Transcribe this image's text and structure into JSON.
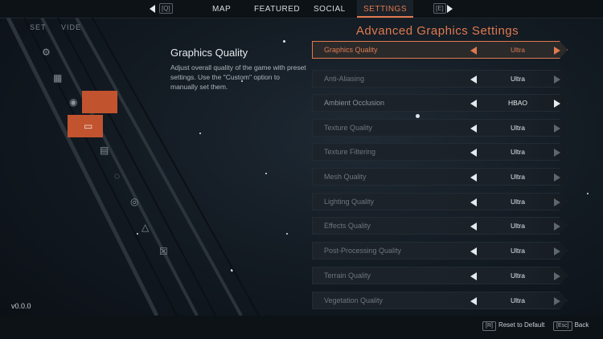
{
  "nav": {
    "prev_key": "[Q]",
    "next_key": "[E]",
    "tabs": [
      "MAP",
      "FEATURED",
      "SOCIAL",
      "SETTINGS"
    ],
    "active_tab": "SETTINGS"
  },
  "left_panel": {
    "labels": [
      "SET",
      "VIDE"
    ]
  },
  "description": {
    "title": "Graphics Quality",
    "body": "Adjust overall quality of the game with preset settings. Use the \"Custom\" option to manually set them."
  },
  "panel": {
    "title": "Advanced Graphics Settings",
    "settings": [
      {
        "label": "Graphics Quality",
        "value": "Ultra"
      },
      {
        "label": "Anti-Aliasing",
        "value": "Ultra"
      },
      {
        "label": "Ambient Occlusion",
        "value": "HBAO"
      },
      {
        "label": "Texture Quality",
        "value": "Ultra"
      },
      {
        "label": "Texture Filtering",
        "value": "Ultra"
      },
      {
        "label": "Mesh Quality",
        "value": "Ultra"
      },
      {
        "label": "Lighting Quality",
        "value": "Ultra"
      },
      {
        "label": "Effects Quality",
        "value": "Ultra"
      },
      {
        "label": "Post-Processing Quality",
        "value": "Ultra"
      },
      {
        "label": "Terrain Quality",
        "value": "Ultra"
      },
      {
        "label": "Vegetation Quality",
        "value": "Ultra"
      }
    ]
  },
  "footer": {
    "version": "v0.0.0",
    "reset_key": "[R]",
    "reset_label": "Reset to Default",
    "back_key": "[Esc]",
    "back_label": "Back"
  },
  "colors": {
    "accent": "#e07a4f",
    "background": "#131b23",
    "text": "#c9cfd6"
  },
  "icons": [
    "chevron-left-icon",
    "chevron-right-icon",
    "gear-icon",
    "monitor-icon",
    "controller-icon",
    "audio-icon",
    "chat-icon",
    "accessibility-icon",
    "warning-icon",
    "x-icon"
  ]
}
